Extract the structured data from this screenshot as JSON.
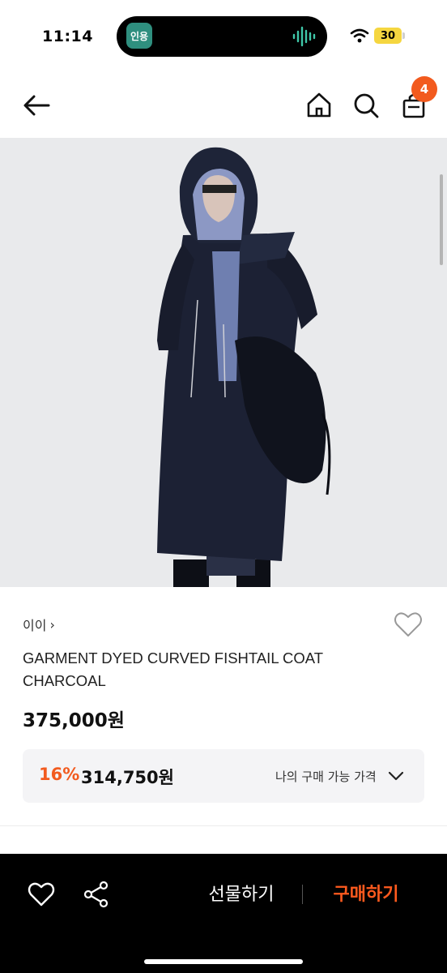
{
  "status_bar": {
    "time": "11:14",
    "island_app_label": "인용",
    "battery": "30",
    "icons": [
      "wifi-icon",
      "battery-icon",
      "audio-wave-icon"
    ]
  },
  "nav": {
    "cart_count": "4",
    "icons": [
      "back-arrow-icon",
      "home-icon",
      "search-icon",
      "cart-icon"
    ]
  },
  "product": {
    "brand": "이이",
    "brand_chevron": "›",
    "title": "GARMENT DYED CURVED FISHTAIL COAT CHARCOAL",
    "price": "375,000원",
    "discount": {
      "rate": "16%",
      "price": "314,750원",
      "label": "나의 구매 가능 가격"
    }
  },
  "bottom_bar": {
    "gift_label": "선물하기",
    "buy_label": "구매하기",
    "icons": [
      "heart-icon",
      "share-icon"
    ]
  },
  "colors": {
    "accent": "#f25a1e",
    "buy_text": "#ff5a1e",
    "bar_bg": "#000000",
    "discount_bg": "#f4f4f6"
  }
}
